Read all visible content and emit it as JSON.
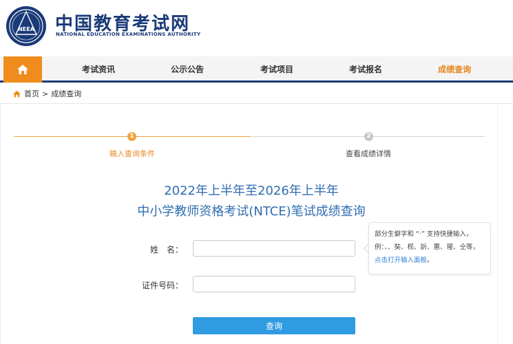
{
  "header": {
    "brand_cn": "中国教育考试网",
    "brand_en": "NATIONAL EDUCATION EXAMINATIONS AUTHORITY",
    "logo_text": "NEEA",
    "brand_color": "#1a3a78"
  },
  "nav": {
    "home_icon": "home-icon",
    "items": [
      {
        "label": "考试资讯",
        "active": false
      },
      {
        "label": "公示公告",
        "active": false
      },
      {
        "label": "考试项目",
        "active": false
      },
      {
        "label": "考试报名",
        "active": false
      },
      {
        "label": "成绩查询",
        "active": true
      }
    ],
    "accent_color": "#f08c1e"
  },
  "breadcrumb": {
    "home": "首页",
    "separator": ">",
    "current": "成绩查询"
  },
  "steps": [
    {
      "number": "1",
      "label": "输入查询条件",
      "active": true
    },
    {
      "number": "2",
      "label": "查看成绩详情",
      "active": false
    }
  ],
  "title": {
    "line1": "2022年上半年至2026年上半年",
    "line2": "中小学教师资格考试(NTCE)笔试成绩查询"
  },
  "form": {
    "name_label": "姓　名：",
    "name_value": "",
    "id_label": "证件号码：",
    "id_value": "",
    "submit_label": "查询"
  },
  "tooltip": {
    "text": "部分生僻字和 “·” 支持快捷输入，例：、、奘、枧、訢、惠、瑆、仝等，",
    "link": "点击打开输入面板",
    "end": "。"
  }
}
